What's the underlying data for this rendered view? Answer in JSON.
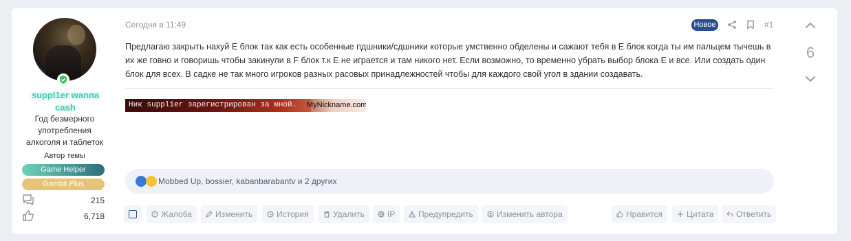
{
  "post": {
    "date": "Сегодня в 11:49",
    "new_badge": "Новое",
    "number": "#1",
    "body": "Предлагаю закрыть нахуй E блок так как есть особенные пдшники/сдшники которые умственно обделены и сажают тебя в E блок когда ты им пальцем тычешь в их же говно и говоришь чтобы закинули в F блок т.к E не играется и там никого нет. Если возможно, то временно убрать выбор блока E и все. Или создать один блок для всех. В садке не так много игроков разных расовых принадлежностей чтобы для каждого свой угол в здании создавать.",
    "userbar_text": "Ник suppl1er зарегистрирован за мной.",
    "userbar_site": "MyNickname.com",
    "reactions_text": "Mobbed Up, bossier, kabanbarabantv и 2 других",
    "score": "6"
  },
  "user": {
    "name": "suppl1er wanna cash",
    "title": "Год безмерного употребления алкоголя и таблеток",
    "author_label": "Автор темы",
    "banners": [
      "Game Helper",
      "Gambit Plus"
    ],
    "messages": "215",
    "likes": "6,718"
  },
  "actions": {
    "report": "Жалоба",
    "edit": "Изменить",
    "history": "История",
    "delete": "Удалить",
    "ip": "IP",
    "warn": "Предупредить",
    "change_author": "Изменить автора",
    "like": "Нравится",
    "quote": "Цитата",
    "reply": "Ответить"
  },
  "colors": {
    "accent": "#2a4e8f",
    "username": "#4fc7b0",
    "muted": "#8c95a1"
  }
}
